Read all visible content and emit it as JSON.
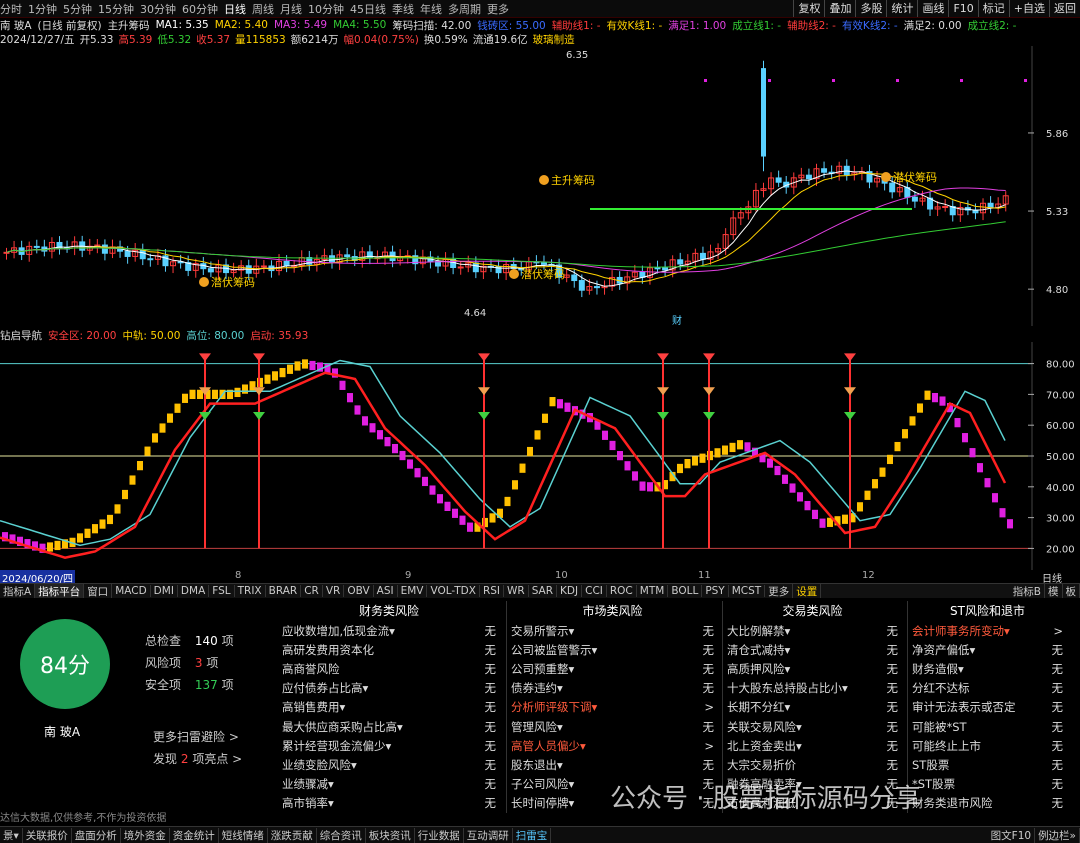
{
  "toolbar": {
    "periods": [
      "分时",
      "1分钟",
      "5分钟",
      "15分钟",
      "30分钟",
      "60分钟",
      "日线",
      "周线",
      "月线",
      "10分钟",
      "45日线",
      "季线",
      "年线",
      "多周期",
      "更多"
    ],
    "active_period": "日线",
    "right_buttons": [
      "复权",
      "叠加",
      "多股",
      "统计",
      "画线",
      "F10",
      "标记",
      "+自选",
      "返回"
    ]
  },
  "price_info": {
    "name": "南 玻A",
    "mode": "(日线 前复权)",
    "indicator": "主升筹码",
    "ma1": "MA1: 5.35",
    "ma2": "MA2: 5.40",
    "ma3": "MA3: 5.49",
    "ma4": "MA4: 5.50",
    "scan": "筹码扫描: 42.00",
    "zone": "钱砖区: 55.00",
    "aux1": "辅助线1: -",
    "valid1": "有效K线1: -",
    "full1": "满足1: 1.00",
    "deal1": "成立线1: -",
    "aux2": "辅助线2: -",
    "valid2": "有效K线2: -",
    "full2": "满足2: 0.00",
    "deal2": "成立线2: -"
  },
  "quote": {
    "date": "2024/12/27/五",
    "open": "开5.33",
    "high": "高5.39",
    "low": "低5.32",
    "close": "收5.37",
    "volume": "量115853",
    "amount": "额6214万",
    "change": "幅0.04(0.75%)",
    "turnover": "换0.59%",
    "float": "流通19.6亿",
    "industry": "玻璃制造"
  },
  "price_axis": [
    "5.86",
    "5.33",
    "4.80"
  ],
  "annotations": {
    "high": "6.35",
    "low": "4.64",
    "fin": "财",
    "chip": "潜伏筹码",
    "main_up": "主升筹码"
  },
  "osc": {
    "name": "钻启导航",
    "safe": "安全区: 20.00",
    "mid": "中轨: 50.00",
    "high": "高位: 80.00",
    "start": "启动: 35.93",
    "axis": [
      "80.00",
      "70.00",
      "60.00",
      "50.00",
      "40.00",
      "30.00",
      "20.00"
    ]
  },
  "date_axis": {
    "start": "2024/06/20/四",
    "months": [
      "8",
      "9",
      "10",
      "11",
      "12"
    ],
    "right": "日线"
  },
  "indicator_tabs": [
    "指标A",
    "指标平台",
    "窗口",
    "MACD",
    "DMI",
    "DMA",
    "FSL",
    "TRIX",
    "BRAR",
    "CR",
    "VR",
    "OBV",
    "ASI",
    "EMV",
    "VOL-TDX",
    "RSI",
    "WR",
    "SAR",
    "KDJ",
    "CCI",
    "ROC",
    "MTM",
    "BOLL",
    "PSY",
    "MCST",
    "更多",
    "设置"
  ],
  "indicator_tabs_right": [
    "指标B",
    "模",
    "板"
  ],
  "risk": {
    "score": "84分",
    "total_label": "总检查",
    "total": "140",
    "unit": "项",
    "risk_label": "风险项",
    "risk_count": "3",
    "safe_label": "安全项",
    "safe_count": "137",
    "stock_name": "南 玻A",
    "more": "更多扫雷避险 >",
    "found_prefix": "发现",
    "found_count": "2",
    "found_suffix": "项亮点 >",
    "disclaimer": "达信大数据,仅供参考,不作为投资依据",
    "columns": [
      {
        "title": "财务类风险",
        "rows": [
          {
            "t": "应收数增加,低现金流▾",
            "v": "无"
          },
          {
            "t": "高研发费用资本化",
            "v": "无"
          },
          {
            "t": "高商誉风险",
            "v": "无"
          },
          {
            "t": "应付债券占比高▾",
            "v": "无"
          },
          {
            "t": "高销售费用▾",
            "v": "无"
          },
          {
            "t": "最大供应商采购占比高▾",
            "v": "无"
          },
          {
            "t": "累计经营现金流偏少▾",
            "v": "无"
          },
          {
            "t": "业绩变脸风险▾",
            "v": "无"
          },
          {
            "t": "业绩骤减▾",
            "v": "无"
          },
          {
            "t": "高市销率▾",
            "v": "无"
          }
        ]
      },
      {
        "title": "市场类风险",
        "rows": [
          {
            "t": "交易所警示▾",
            "v": "无"
          },
          {
            "t": "公司被监管警示▾",
            "v": "无"
          },
          {
            "t": "公司预重整▾",
            "v": "无"
          },
          {
            "t": "债券违约▾",
            "v": "无"
          },
          {
            "t": "分析师评级下调▾",
            "v": ">",
            "hl": true
          },
          {
            "t": "管理风险▾",
            "v": "无"
          },
          {
            "t": "高管人员偏少▾",
            "v": ">",
            "hl": true
          },
          {
            "t": "股东退出▾",
            "v": "无"
          },
          {
            "t": "子公司风险▾",
            "v": "无"
          },
          {
            "t": "长时间停牌▾",
            "v": "无"
          }
        ]
      },
      {
        "title": "交易类风险",
        "rows": [
          {
            "t": "大比例解禁▾",
            "v": "无"
          },
          {
            "t": "清仓式减持▾",
            "v": "无"
          },
          {
            "t": "高质押风险▾",
            "v": "无"
          },
          {
            "t": "十大股东总持股占比小▾",
            "v": "无"
          },
          {
            "t": "长期不分红▾",
            "v": "无"
          },
          {
            "t": "关联交易风险▾",
            "v": "无"
          },
          {
            "t": "北上资金卖出▾",
            "v": "无"
          },
          {
            "t": "大宗交易折价",
            "v": "无"
          },
          {
            "t": "融券高融卖率▾",
            "v": "无"
          },
          {
            "t": "市值高利润低",
            "v": "无"
          }
        ]
      },
      {
        "title": "ST风险和退市",
        "rows": [
          {
            "t": "会计师事务所变动▾",
            "v": ">",
            "hl": true
          },
          {
            "t": "净资产偏低▾",
            "v": "无"
          },
          {
            "t": "财务造假▾",
            "v": "无"
          },
          {
            "t": "分红不达标",
            "v": "无"
          },
          {
            "t": "审计无法表示或否定",
            "v": "无"
          },
          {
            "t": "可能被*ST",
            "v": "无"
          },
          {
            "t": "可能终止上市",
            "v": "无"
          },
          {
            "t": "ST股票",
            "v": "无"
          },
          {
            "t": "*ST股票",
            "v": "无"
          },
          {
            "t": "财务类退市风险",
            "v": "无"
          }
        ]
      }
    ]
  },
  "statusbar": [
    "景▾",
    "关联报价",
    "盘面分析",
    "境外资金",
    "资金统计",
    "短线情绪",
    "涨跌贡献",
    "综合资讯",
    "板块资讯",
    "行业数据",
    "互动调研",
    "扫雷宝"
  ],
  "statusbar_active": "扫雷宝",
  "statusbar_right": [
    "图文F10",
    "例边栏»"
  ],
  "watermark": "公众号 · 股票指标源码分享",
  "colors": {
    "red": "#ff3b3b",
    "yellow": "#ffcc00",
    "magenta": "#e020e0",
    "cyan": "#5ad1d1",
    "green": "#1e9e55"
  }
}
